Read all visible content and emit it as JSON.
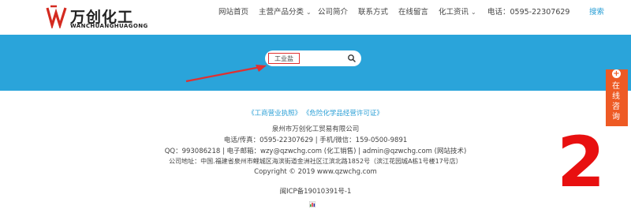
{
  "header": {
    "logo_cn": "万创化工",
    "logo_en": "WANCHUANGHUAGONG",
    "nav": [
      {
        "label": "网站首页"
      },
      {
        "label": "主营产品分类",
        "dropdown": true
      },
      {
        "label": "公司简介"
      },
      {
        "label": "联系方式"
      },
      {
        "label": "在线留言"
      },
      {
        "label": "化工资讯",
        "dropdown": true
      },
      {
        "label": "电话：0595-22307629"
      },
      {
        "label": "搜索"
      }
    ]
  },
  "banner": {
    "search_value": "工业盐",
    "search_icon": "search-icon"
  },
  "footer": {
    "link1": "《工商营业执照》",
    "link2": "《危险化学品经营许可证》",
    "company": "泉州市万创化工贸易有限公司",
    "phone_line": "电话/传真：0595-22307629 | 手机/微信：159-0500-9891",
    "qq_line": "QQ：993086218 | 电子邮箱：wzy@qzwchg.com (化工销售) | admin@qzwchg.com (网站技术)",
    "address_line": "公司地址：中国.福建省泉州市鲤城区海滨街道金洲社区江滨北路1852号（滨江花园城A栋1号楼17号店）",
    "copyright": "Copyright © 2019 www.qzwchg.com",
    "icp": "闽ICP备19010391号-1"
  },
  "side_widget": {
    "label_chars": [
      "在",
      "线",
      "咨",
      "询"
    ]
  },
  "overlay_number": "2",
  "colors": {
    "banner": "#2aa4da",
    "accent_link": "#2a9fd6",
    "side_widget": "#ee5a24",
    "annotation_red": "#e81010"
  }
}
